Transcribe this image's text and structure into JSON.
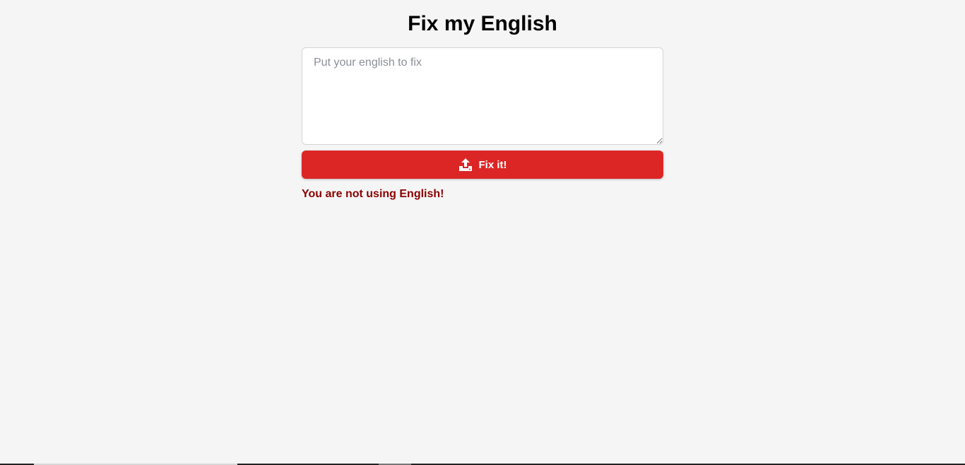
{
  "header": {
    "title": "Fix my English"
  },
  "form": {
    "input_value": "",
    "input_placeholder": "Put your english to fix",
    "submit_label": "Fix it!",
    "submit_icon": "upload-icon"
  },
  "status": {
    "error_message": "You are not using English!"
  },
  "colors": {
    "background": "#f5f5f5",
    "button": "#dc2626",
    "error_text": "#8b0000"
  }
}
